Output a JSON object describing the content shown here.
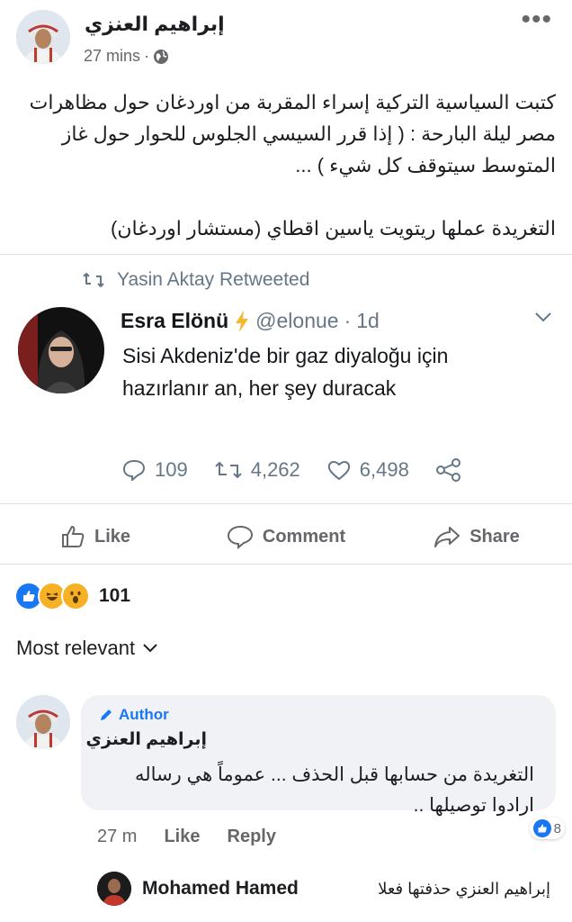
{
  "post": {
    "author": "إبراهيم العنزي",
    "time": "27 mins",
    "more_icon": "•••",
    "body_lines": [
      "كتبت السياسية التركية إسراء المقربة من اوردغان حول مظاهرات",
      "مصر ليلة البارحة : ( إذا قرر السيسي الجلوس للحوار حول غاز",
      "المتوسط سيتوقف كل شيء ) ...",
      "",
      "التغريدة عملها ريتويت ياسين اقطاي (مستشار اوردغان)"
    ]
  },
  "tweet": {
    "retweet_label": "Yasin Aktay Retweeted",
    "name": "Esra Elönü",
    "handle": "@elonue",
    "separator": "·",
    "time": "1d",
    "text_lines": [
      "Sisi Akdeniz'de bir gaz diyaloğu için",
      "hazırlanır an, her şey duracak"
    ],
    "replies": "109",
    "retweets": "4,262",
    "likes": "6,498"
  },
  "actions": {
    "like": "Like",
    "comment": "Comment",
    "share": "Share"
  },
  "reactions": {
    "count": "101",
    "colors": {
      "like": "#1877f2",
      "haha": "#f7b125",
      "wow": "#f7b125"
    }
  },
  "sort": {
    "label": "Most relevant"
  },
  "comment": {
    "badge": "Author",
    "name": "إبراهيم العنزي",
    "text_lines": [
      "التغريدة من حسابها قبل الحذف ... عموماً هي رساله",
      "ارادوا توصيلها .."
    ],
    "time": "27 m",
    "like": "Like",
    "reply": "Reply",
    "like_count": "8"
  },
  "reply": {
    "name": "Mohamed Hamed",
    "text": "إبراهيم العنزي  حذفتها فعلا"
  },
  "colors": {
    "brand_blue": "#1877f2",
    "text_grey": "#65676b",
    "twitter_grey": "#657786",
    "retweet_icon": "#657786",
    "verified_bolt": "#f5b82e"
  }
}
